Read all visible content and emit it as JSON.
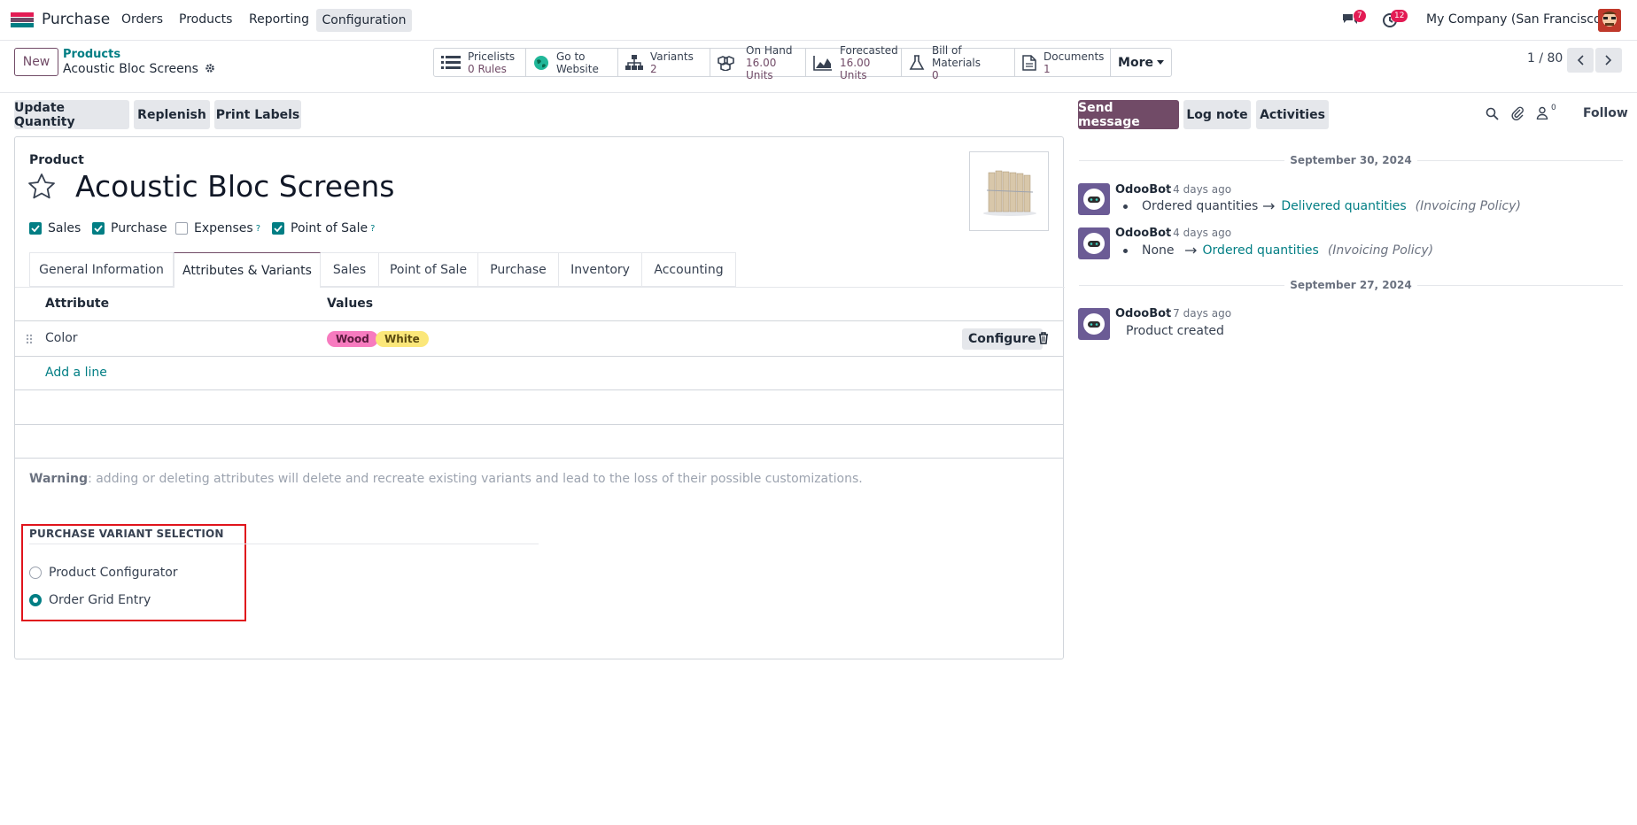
{
  "navbar": {
    "app_name": "Purchase",
    "menu": [
      "Orders",
      "Products",
      "Reporting",
      "Configuration"
    ],
    "messages_badge": "7",
    "activities_badge": "12",
    "company": "My Company (San Francisco)"
  },
  "control_panel": {
    "new_label": "New",
    "breadcrumb_parent": "Products",
    "breadcrumb_current": "Acoustic Bloc Screens",
    "pager": "1 / 80",
    "smart_buttons": [
      {
        "title": "Pricelists",
        "value": "0 Rules"
      },
      {
        "title": "Go to",
        "value": "Website"
      },
      {
        "title": "Variants",
        "value": "2"
      },
      {
        "title": "On Hand",
        "value": "16.00 Units"
      },
      {
        "title": "Forecasted",
        "value": "16.00 Units"
      },
      {
        "title": "Bill of Materials",
        "value": "0"
      },
      {
        "title": "Documents",
        "value": "1"
      }
    ],
    "more_label": "More"
  },
  "actions": [
    "Update Quantity",
    "Replenish",
    "Print Labels"
  ],
  "form": {
    "product_label": "Product",
    "product_name": "Acoustic Bloc Screens",
    "checkboxes": [
      {
        "label": "Sales",
        "checked": true
      },
      {
        "label": "Purchase",
        "checked": true
      },
      {
        "label": "Expenses",
        "checked": false,
        "help": "?"
      },
      {
        "label": "Point of Sale",
        "checked": true,
        "help": "?"
      }
    ],
    "tabs": [
      "General Information",
      "Attributes & Variants",
      "Sales",
      "Point of Sale",
      "Purchase",
      "Inventory",
      "Accounting"
    ],
    "active_tab": "Attributes & Variants",
    "table": {
      "headers": [
        "Attribute",
        "Values"
      ],
      "rows": [
        {
          "attribute": "Color",
          "values": [
            "Wood",
            "White"
          ],
          "configure": "Configure"
        }
      ],
      "add_line": "Add a line"
    },
    "warning_bold": "Warning",
    "warning_text": ": adding or deleting attributes will delete and recreate existing variants and lead to the loss of their possible customizations.",
    "variant_section": {
      "title": "PURCHASE VARIANT SELECTION",
      "options": [
        {
          "label": "Product Configurator",
          "selected": false
        },
        {
          "label": "Order Grid Entry",
          "selected": true
        }
      ]
    }
  },
  "chatter": {
    "send_message": "Send message",
    "log_note": "Log note",
    "activities": "Activities",
    "followers_count": "0",
    "follow": "Follow",
    "groups": [
      {
        "date": "September 30, 2024",
        "messages": [
          {
            "author": "OdooBot",
            "time": "- 4 days ago",
            "old": "Ordered quantities",
            "new": "Delivered quantities",
            "field": "(Invoicing Policy)"
          },
          {
            "author": "OdooBot",
            "time": "- 4 days ago",
            "old": "None",
            "new": "Ordered quantities",
            "field": "(Invoicing Policy)"
          }
        ]
      },
      {
        "date": "September 27, 2024",
        "messages": [
          {
            "author": "OdooBot",
            "time": "- 7 days ago",
            "body": "Product created"
          }
        ]
      }
    ]
  },
  "colors": {
    "brand": "#714b67",
    "teal": "#017e84",
    "wood_tag": "#f77bbf",
    "white_tag": "#fbe77a",
    "highlight": "#e0141c"
  }
}
